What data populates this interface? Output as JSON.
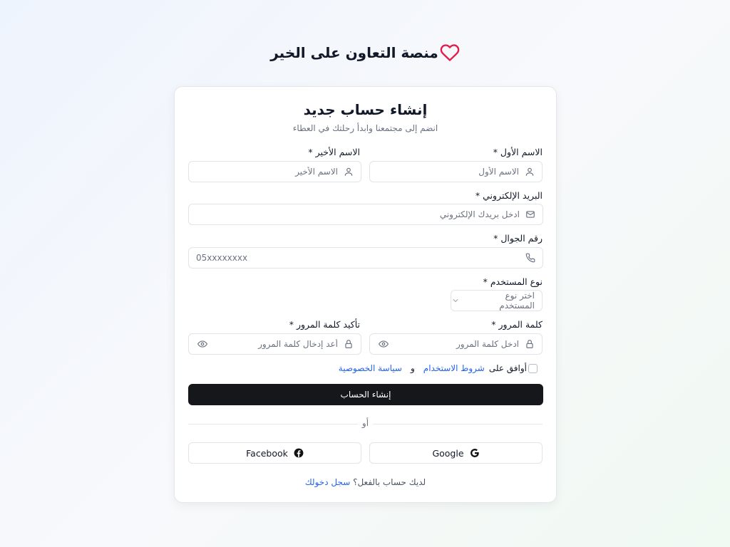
{
  "brand": {
    "title": "منصة التعاون على الخير"
  },
  "card": {
    "title": "إنشاء حساب جديد",
    "subtitle": "انضم إلى مجتمعنا وابدأ رحلتك في العطاء"
  },
  "form": {
    "first_name": {
      "label": "الاسم الأول *",
      "placeholder": "الاسم الأول",
      "value": ""
    },
    "last_name": {
      "label": "الاسم الأخير *",
      "placeholder": "الاسم الأخير",
      "value": ""
    },
    "email": {
      "label": "البريد الإلكتروني *",
      "placeholder": "ادخل بريدك الإلكتروني",
      "value": ""
    },
    "phone": {
      "label": "رقم الجوال *",
      "placeholder": "05xxxxxxxx",
      "value": ""
    },
    "user_type": {
      "label": "نوع المستخدم *",
      "selected": "اختر نوع المستخدم"
    },
    "password": {
      "label": "كلمة المرور *",
      "placeholder": "ادخل كلمة المرور",
      "value": ""
    },
    "confirm_password": {
      "label": "تأكيد كلمة المرور *",
      "placeholder": "أعد إدخال كلمة المرور",
      "value": ""
    },
    "agree": {
      "prefix": "أوافق على",
      "terms": "شروط الاستخدام",
      "and": "و",
      "privacy": "سياسة الخصوصية",
      "checked": false
    },
    "submit_label": "إنشاء الحساب"
  },
  "divider": {
    "text": "أو"
  },
  "social": {
    "google": "Google",
    "facebook": "Facebook"
  },
  "footer": {
    "question": "لديك حساب بالفعل؟",
    "login": "سجل دخولك"
  },
  "colors": {
    "accent": "#2563eb",
    "heart": "#e11d48",
    "button": "#16171a"
  }
}
